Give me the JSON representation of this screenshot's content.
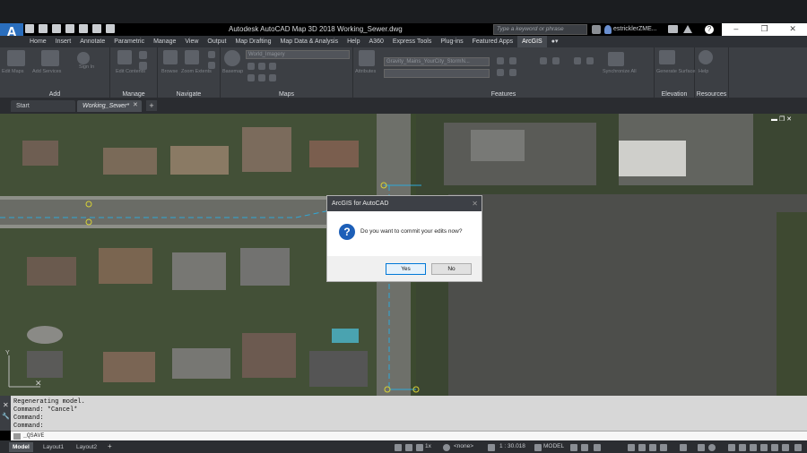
{
  "window": {
    "title": "Autodesk AutoCAD Map 3D 2018    Working_Sewer.dwg",
    "app_logo": "A",
    "search_placeholder": "Type a keyword or phrase",
    "user": "estricklerZME...",
    "buttons": [
      "–",
      "❐",
      "✕"
    ]
  },
  "ribbon_tabs": [
    "Home",
    "Insert",
    "Annotate",
    "Parametric",
    "Manage",
    "View",
    "Output",
    "Map Drafting",
    "Map Data & Analysis",
    "Help",
    "A360",
    "Express Tools",
    "Plug-ins",
    "Featured Apps",
    "ArcGIS"
  ],
  "ribbon_active_tab": "ArcGIS",
  "ribbon_panels": {
    "add": {
      "label": "Add",
      "items": [
        "Edit Maps",
        "Add Services",
        "Sign In"
      ]
    },
    "manage": {
      "label": "Manage",
      "items": [
        "Edit Contents"
      ]
    },
    "navigate": {
      "label": "Navigate",
      "items": [
        "Browse",
        "Zoom Extents"
      ]
    },
    "maps": {
      "label": "Maps",
      "basemap": "World_Imagery",
      "items": [
        "Basemap"
      ]
    },
    "features": {
      "label": "Features",
      "layer": "Gravity_Mains_YourCity_StormN...",
      "items": [
        "Attributes"
      ]
    },
    "synchronize": {
      "items": [
        "Synchronize All"
      ]
    },
    "elevation": {
      "label": "Elevation",
      "items": [
        "Generate Surface"
      ]
    },
    "resources": {
      "label": "Resources",
      "items": [
        "Help"
      ]
    }
  },
  "doc_tabs": [
    "Start",
    "Working_Sewer*"
  ],
  "active_doc_tab": "Working_Sewer*",
  "dialog": {
    "title": "ArcGIS for AutoCAD",
    "message": "Do you want to commit your edits now?",
    "yes": "Yes",
    "no": "No",
    "close": "✕"
  },
  "command_history": [
    "Regenerating model.",
    "Command: *Cancel*",
    "Command:",
    "Command:"
  ],
  "command_input": "_QSAVE",
  "layout_tabs": [
    "Model",
    "Layout1",
    "Layout2"
  ],
  "active_layout": "Model",
  "status": {
    "scale": "1x",
    "annotation": "<none>",
    "ratio": "1 : 30.018",
    "space": "MODEL"
  },
  "colors": {
    "accent": "#1d5fb8",
    "sewer_line": "#2ea8d8",
    "vertex": "#d7d236"
  }
}
